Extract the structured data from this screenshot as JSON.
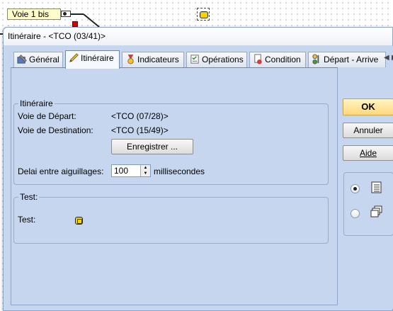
{
  "background": {
    "track_label": "Voie 1 bis"
  },
  "dialog": {
    "title": "Itinéraire - <TCO (03/41)>",
    "tabs": [
      {
        "label": "Général",
        "icon": "wrench-icon"
      },
      {
        "label": "Itinéraire",
        "icon": "pencil-icon"
      },
      {
        "label": "Indicateurs",
        "icon": "medal-icon"
      },
      {
        "label": "Opérations",
        "icon": "checklist-icon"
      },
      {
        "label": "Condition",
        "icon": "document-red-icon"
      },
      {
        "label": "Départ - Arrive",
        "icon": "traffic-light-icon"
      }
    ],
    "active_tab": "Itinéraire",
    "itineraire_group": {
      "legend": "Itinéraire",
      "depart_label": "Voie de Départ:",
      "depart_value": "<TCO (07/28)>",
      "destination_label": "Voie de Destination:",
      "destination_value": "<TCO (15/49)>",
      "register_button": "Enregistrer ...",
      "delay_label": "Delai entre aiguillages:",
      "delay_value": "100",
      "delay_unit": "millisecondes"
    },
    "test_group": {
      "legend": "Test:",
      "label": "Test:"
    },
    "buttons": {
      "ok": "OK",
      "cancel": "Annuler",
      "help": "Aide"
    },
    "view_options": [
      {
        "icon": "list-view-icon",
        "checked": true
      },
      {
        "icon": "cascade-windows-icon",
        "checked": false
      }
    ]
  }
}
